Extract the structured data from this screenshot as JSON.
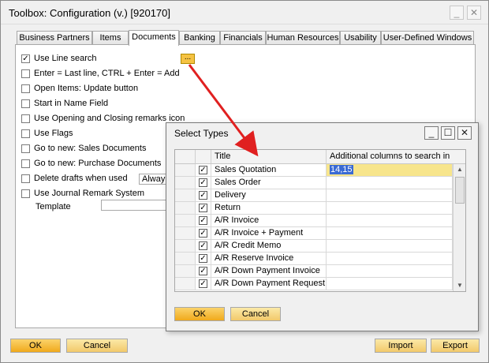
{
  "window": {
    "title": "Toolbox: Configuration (v.) [920170]",
    "minimize": "_",
    "close": "✕"
  },
  "tabs": [
    {
      "label": "Business Partners"
    },
    {
      "label": "Items"
    },
    {
      "label": "Documents"
    },
    {
      "label": "Banking"
    },
    {
      "label": "Financials"
    },
    {
      "label": "Human Resources"
    },
    {
      "label": "Usability"
    },
    {
      "label": "User-Defined Windows"
    }
  ],
  "active_tab": "Documents",
  "options": [
    {
      "label": "Use Line search",
      "checked": true
    },
    {
      "label": "Enter = Last line, CTRL + Enter = Add",
      "checked": false
    },
    {
      "label": "Open Items: Update button",
      "checked": false
    },
    {
      "label": "Start in Name Field",
      "checked": false
    },
    {
      "label": "Use Opening and Closing remarks icon",
      "checked": false
    },
    {
      "label": "Use Flags",
      "checked": false
    },
    {
      "label": "Go to new: Sales Documents",
      "checked": false
    },
    {
      "label": "Go to new: Purchase Documents",
      "checked": false
    },
    {
      "label": "Delete drafts when used",
      "checked": false
    },
    {
      "label": "Use Journal Remark System",
      "checked": false
    }
  ],
  "dots_button": "...",
  "delete_drafts_select": "Alway",
  "template_label": "Template",
  "template_value": "",
  "buttons": {
    "ok": "OK",
    "cancel": "Cancel",
    "import": "Import",
    "export": "Export"
  },
  "dialog": {
    "title": "Select Types",
    "minimize": "_",
    "maximize": "☐",
    "close": "✕",
    "columns": {
      "title": "Title",
      "additional": "Additional columns to search in"
    },
    "rows": [
      {
        "title": "Sales Quotation",
        "checked": true,
        "additional": "14,15"
      },
      {
        "title": "Sales Order",
        "checked": true,
        "additional": ""
      },
      {
        "title": "Delivery",
        "checked": true,
        "additional": ""
      },
      {
        "title": "Return",
        "checked": true,
        "additional": ""
      },
      {
        "title": "A/R Invoice",
        "checked": true,
        "additional": ""
      },
      {
        "title": "A/R Invoice + Payment",
        "checked": true,
        "additional": ""
      },
      {
        "title": "A/R Credit Memo",
        "checked": true,
        "additional": ""
      },
      {
        "title": "A/R Reserve Invoice",
        "checked": true,
        "additional": ""
      },
      {
        "title": "A/R Down Payment Invoice",
        "checked": true,
        "additional": ""
      },
      {
        "title": "A/R Down Payment Request",
        "checked": true,
        "additional": ""
      }
    ],
    "ok": "OK",
    "cancel": "Cancel"
  },
  "colors": {
    "accent": "#f0a91c",
    "selection": "#3a6ad4",
    "highlight_cell": "#f7e58c",
    "arrow": "#e02020"
  }
}
